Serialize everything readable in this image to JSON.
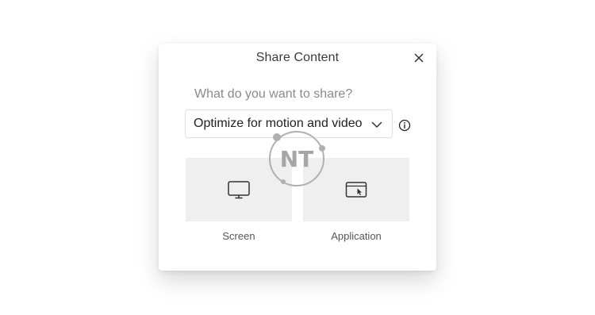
{
  "dialog": {
    "title": "Share Content",
    "close_icon": "close-icon",
    "question": "What do you want to share?",
    "select": {
      "value": "Optimize for motion and video",
      "icon": "chevron-down-icon"
    },
    "info_icon": "info-icon",
    "options": [
      {
        "label": "Screen",
        "icon": "monitor-icon"
      },
      {
        "label": "Application",
        "icon": "application-window-icon"
      }
    ],
    "tile_color": "#efefef"
  },
  "watermark": {
    "text": "NT"
  }
}
